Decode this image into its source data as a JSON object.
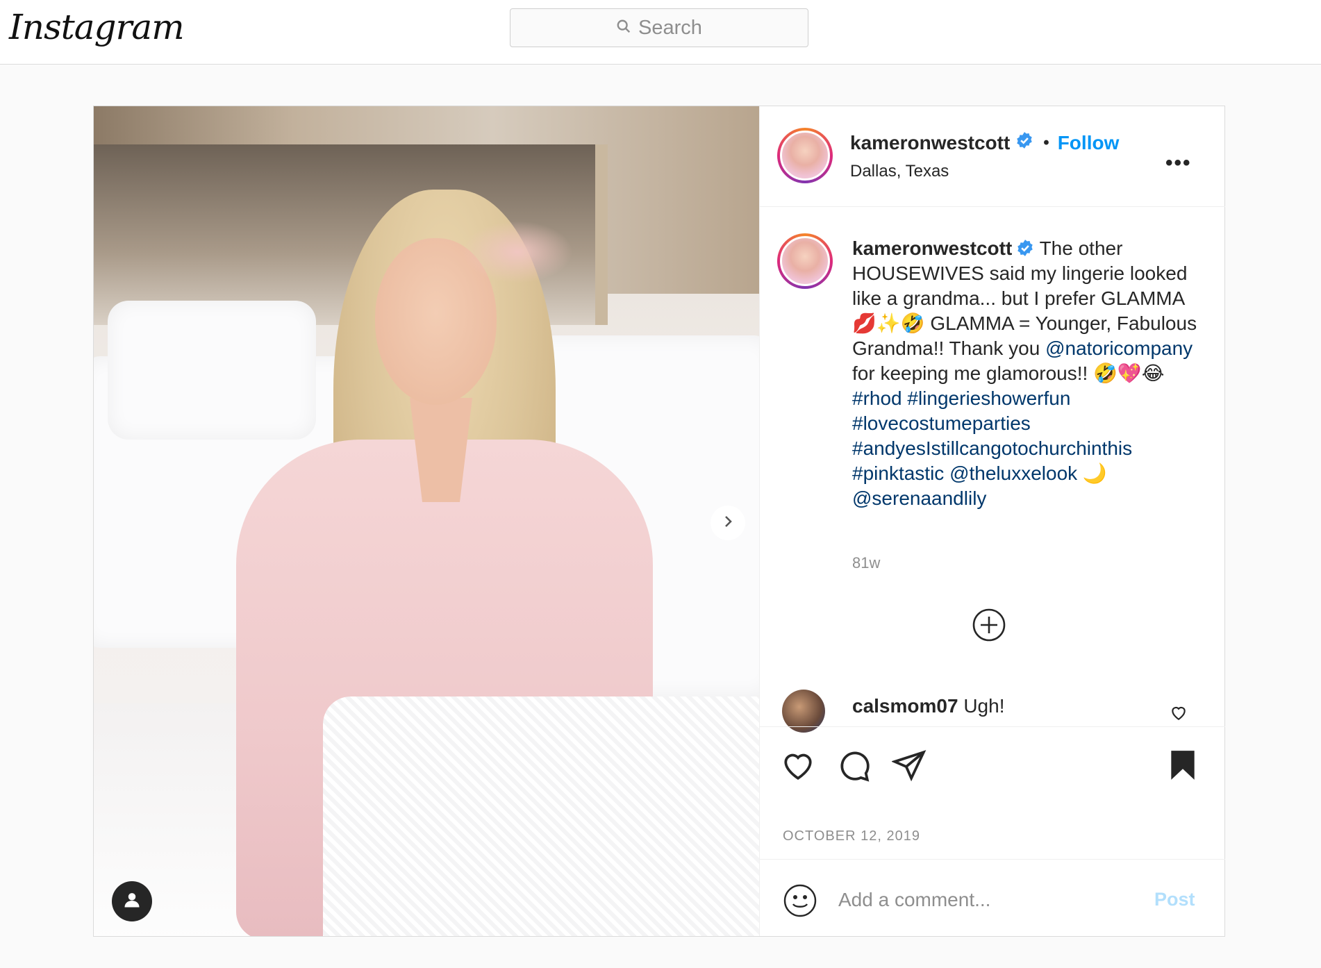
{
  "app": {
    "logo_text": "Instagram"
  },
  "search": {
    "placeholder": "Search"
  },
  "post": {
    "header": {
      "username": "kameronwestcott",
      "separator": "•",
      "follow_label": "Follow",
      "location": "Dallas, Texas",
      "more_label": "•••"
    },
    "caption": {
      "username": "kameronwestcott",
      "text_1": " The other HOUSEWIVES said my lingerie looked like a grandma... but I prefer GLAMMA 💋✨🤣 GLAMMA = Younger, Fabulous Grandma!! Thank you ",
      "mention_1": "@natoricompany",
      "text_2": " for keeping me glamorous!! 🤣💖😂 ",
      "hashtags": "#rhod #lingerieshowerfun #lovecostumeparties #andyesIstillcangotochurchinthis #pinktastic",
      "mention_2": " @theluxxelook",
      "text_3": " 🌙 ",
      "mention_3": "@serenaandlily",
      "age": "81w"
    },
    "comments": [
      {
        "username": "calsmom07",
        "text": " Ugh!"
      }
    ],
    "date": "OCTOBER 12, 2019",
    "add_comment": {
      "placeholder": "Add a comment...",
      "post_label": "Post"
    }
  },
  "colors": {
    "accent": "#0095f6",
    "link": "#00376b",
    "muted": "#8e8e8e",
    "border": "#dbdbdb"
  },
  "icons": {
    "search": "search-icon",
    "verified": "verified-badge-icon",
    "more": "more-options-icon",
    "next": "chevron-right-icon",
    "tag": "user-tag-icon",
    "plus": "plus-circle-icon",
    "like": "heart-icon",
    "comment": "comment-icon",
    "share": "share-icon",
    "save": "bookmark-icon",
    "emoji": "emoji-icon"
  }
}
